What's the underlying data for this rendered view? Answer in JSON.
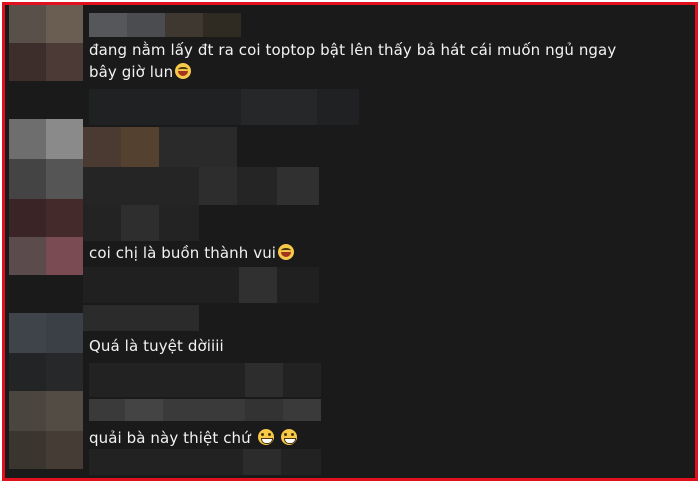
{
  "comments": [
    {
      "text": "đang nằm lấy đt ra coi toptop bật lên thấy bả hát cái muốn ngủ ngay bây giờ lun",
      "emoji": "laughing-tears-emoji"
    },
    {
      "text": "coi chị là buồn thành vui",
      "emoji": "laughing-tears-emoji"
    },
    {
      "text": "Quá là tuyệt dờiiii",
      "emoji": ""
    },
    {
      "text": "quải bà này thiệt chứ",
      "emoji": "grinning-emoji"
    }
  ],
  "colors": {
    "border": "#e0101e",
    "background": "#1a1a1b",
    "text": "#f2f2f2"
  }
}
